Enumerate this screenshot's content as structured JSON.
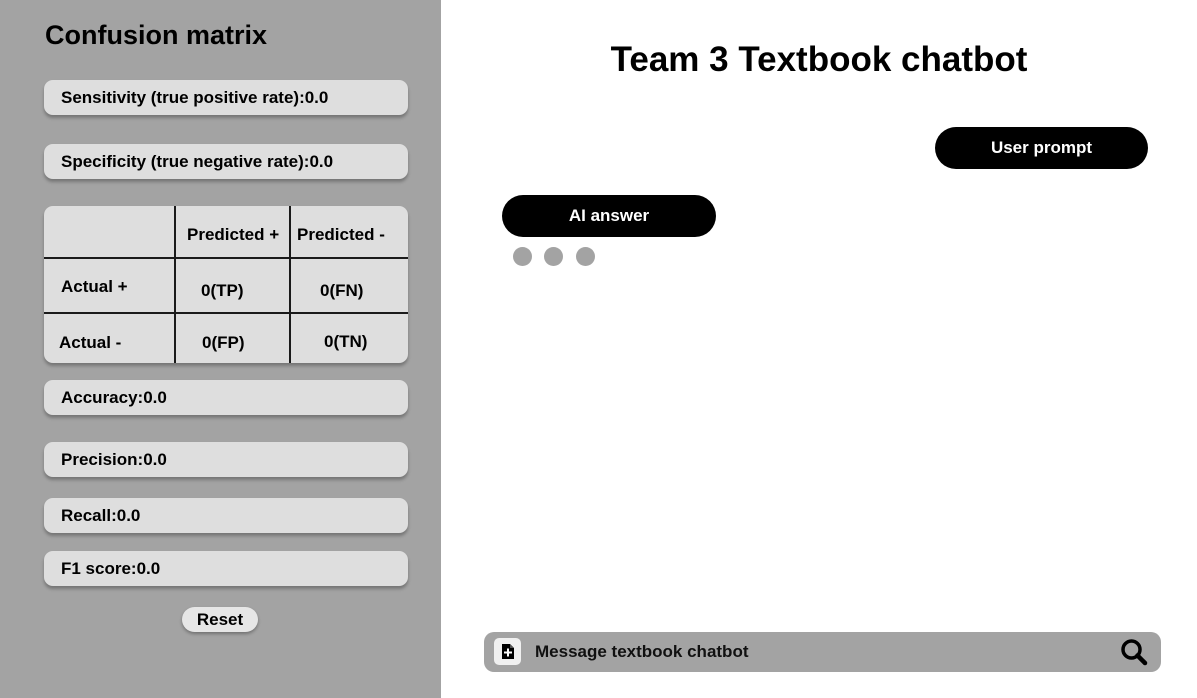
{
  "sidebar": {
    "title": "Confusion matrix",
    "sensitivity": "Sensitivity (true positive rate):0.0",
    "specificity": "Specificity (true negative rate):0.0",
    "matrix": {
      "col_headers": [
        "Predicted +",
        "Predicted -"
      ],
      "rows": [
        {
          "label": "Actual +",
          "cells": [
            "0(TP)",
            "0(FN)"
          ]
        },
        {
          "label": "Actual -",
          "cells": [
            "0(FP)",
            "0(TN)"
          ]
        }
      ]
    },
    "accuracy": "Accuracy:0.0",
    "precision": "Precision:0.0",
    "recall": "Recall:0.0",
    "f1": "F1 score:0.0",
    "reset_label": "Reset"
  },
  "main": {
    "title": "Team 3 Textbook chatbot",
    "user_prompt": "User prompt",
    "ai_answer": "AI answer",
    "typing_dots": 3,
    "message_placeholder": "Message textbook chatbot"
  },
  "colors": {
    "sidebar_bg": "#a3a3a3",
    "card_bg": "#dedede",
    "bubble_bg": "#000000",
    "bubble_text": "#ffffff",
    "dot": "#a3a3a3"
  },
  "icons": {
    "attach": "add-document-icon",
    "search": "search-icon"
  }
}
